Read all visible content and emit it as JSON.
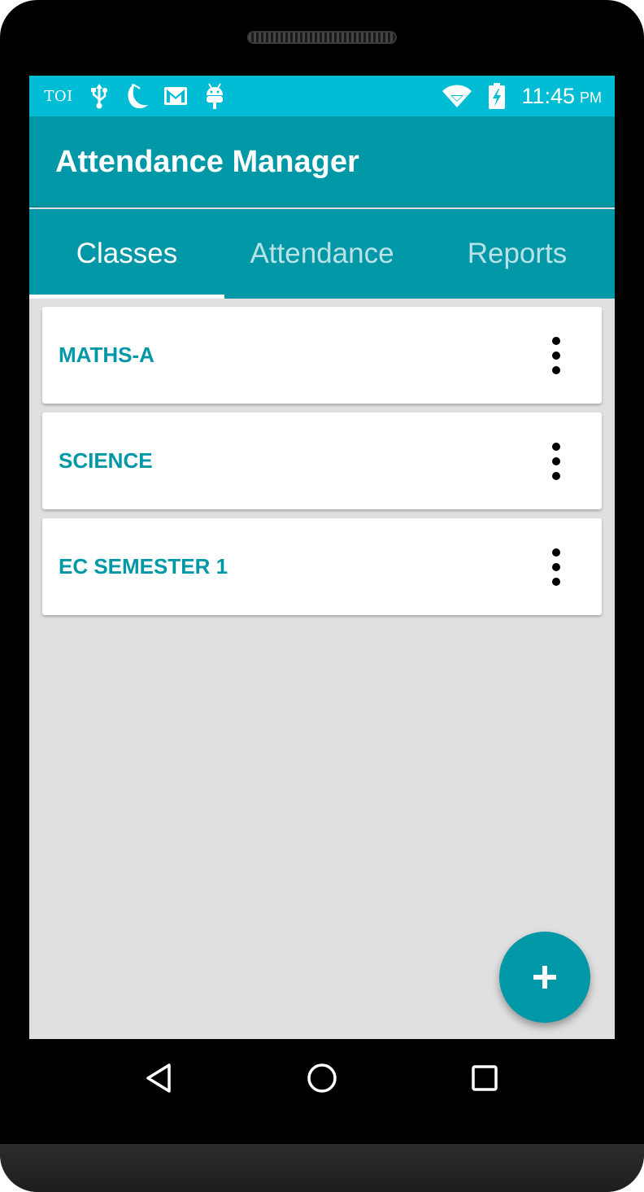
{
  "status_bar": {
    "notification_text": "TOI",
    "notification_icons": [
      "usb-icon",
      "crescent-moon-icon",
      "gmail-icon",
      "android-icon"
    ],
    "system_icons": [
      "wifi-icon",
      "battery-charging-icon"
    ],
    "time": "11:45",
    "ampm": "PM",
    "background_color": "#00bcd4"
  },
  "app_bar": {
    "title": "Attendance Manager",
    "color": "#0097a7"
  },
  "tabs": [
    {
      "label": "Classes",
      "selected": true
    },
    {
      "label": "Attendance",
      "selected": false
    },
    {
      "label": "Reports",
      "selected": false
    }
  ],
  "classes": [
    {
      "name": "MATHS-A",
      "menu_icon": "more-vert-icon"
    },
    {
      "name": "SCIENCE",
      "menu_icon": "more-vert-icon"
    },
    {
      "name": "EC SEMESTER 1",
      "menu_icon": "more-vert-icon"
    }
  ],
  "fab": {
    "icon": "plus-icon",
    "color": "#0097a7"
  },
  "nav_bar": {
    "buttons": [
      "back-triangle-icon",
      "home-circle-icon",
      "recents-square-icon"
    ]
  }
}
